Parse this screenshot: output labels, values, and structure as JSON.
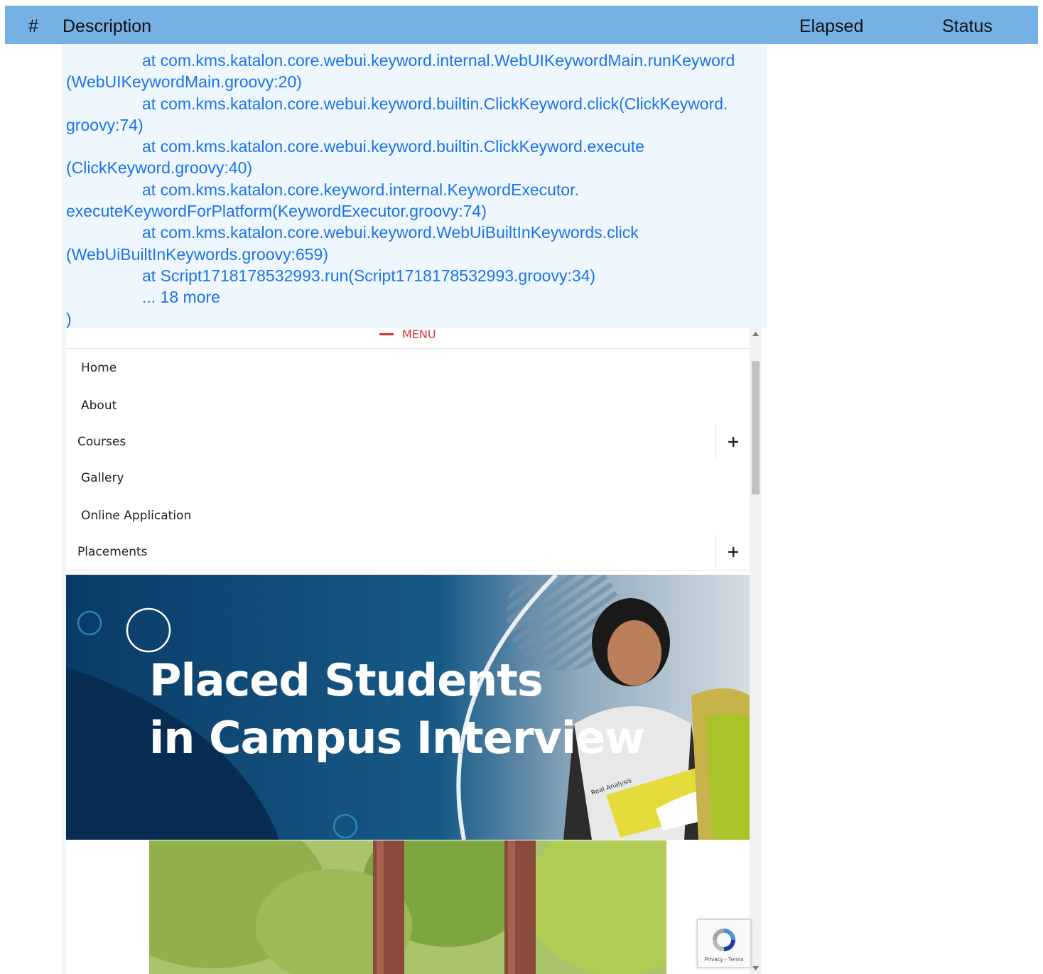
{
  "table_header": {
    "num": "#",
    "description": "Description",
    "elapsed": "Elapsed",
    "status": "Status"
  },
  "log_lines": [
    {
      "text": "at com.kms.katalon.core.webui.keyword.internal.WebUIKeywordMain.runKeyword",
      "indent": true
    },
    {
      "text": "(WebUIKeywordMain.groovy:20)",
      "indent": false
    },
    {
      "text": "at com.kms.katalon.core.webui.keyword.builtin.ClickKeyword.click(ClickKeyword.",
      "indent": true
    },
    {
      "text": "groovy:74)",
      "indent": false
    },
    {
      "text": "at com.kms.katalon.core.webui.keyword.builtin.ClickKeyword.execute",
      "indent": true
    },
    {
      "text": "(ClickKeyword.groovy:40)",
      "indent": false
    },
    {
      "text": "at com.kms.katalon.core.keyword.internal.KeywordExecutor.",
      "indent": true
    },
    {
      "text": "executeKeywordForPlatform(KeywordExecutor.groovy:74)",
      "indent": false
    },
    {
      "text": "at com.kms.katalon.core.webui.keyword.WebUiBuiltInKeywords.click",
      "indent": true
    },
    {
      "text": "(WebUiBuiltInKeywords.groovy:659)",
      "indent": false
    },
    {
      "text": "at Script1718178532993.run(Script1718178532993.groovy:34)",
      "indent": true
    },
    {
      "text": "... 18 more",
      "indent": true
    },
    {
      "text": ")",
      "indent": false
    }
  ],
  "screenshot": {
    "menu_label": "MENU",
    "menu_items": [
      {
        "label": "Home",
        "expandable": false
      },
      {
        "label": "About",
        "expandable": false
      },
      {
        "label": "Courses",
        "expandable": true
      },
      {
        "label": "Gallery",
        "expandable": false
      },
      {
        "label": "Online Application",
        "expandable": false
      },
      {
        "label": "Placements",
        "expandable": true
      }
    ],
    "banner_line1": "Placed Students",
    "banner_line2": "in Campus Interview",
    "book_title": "Real Analysis",
    "recaptcha_terms": "Privacy - Terms"
  },
  "colors": {
    "header_bg": "#76b1e5",
    "log_bg": "#eef7fe",
    "log_text": "#1a73e8",
    "menu_accent": "#d9322e",
    "banner_bg": "#0a3a66"
  }
}
